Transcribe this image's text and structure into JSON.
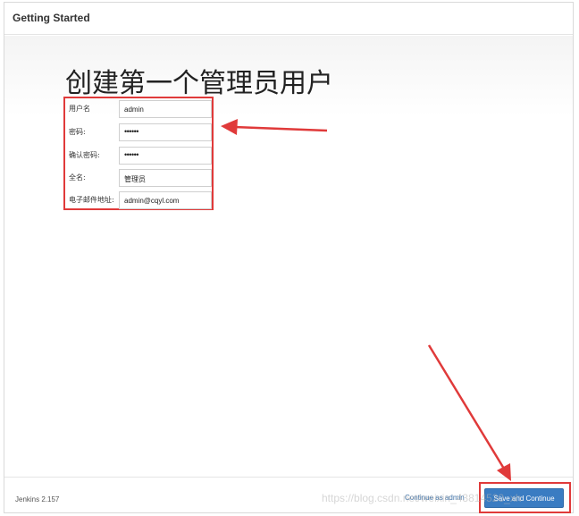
{
  "header": {
    "title": "Getting Started"
  },
  "main": {
    "title": "创建第一个管理员用户",
    "form": [
      {
        "label": "用户名",
        "value": "admin"
      },
      {
        "label": "密码:",
        "value": "••••••"
      },
      {
        "label": "确认密码:",
        "value": "••••••"
      },
      {
        "label": "全名:",
        "value": "管理员"
      },
      {
        "label": "电子邮件地址:",
        "value": "admin@cqyl.com"
      }
    ]
  },
  "footer": {
    "version": "Jenkins 2.157",
    "continue_link": "Continue as admin",
    "save_button": "Save and Continue"
  },
  "watermark": "https://blog.csdn.net/weixin_43814520_xh",
  "colors": {
    "annotation": "#e03a3a",
    "primary_button": "#3a7cc2"
  }
}
